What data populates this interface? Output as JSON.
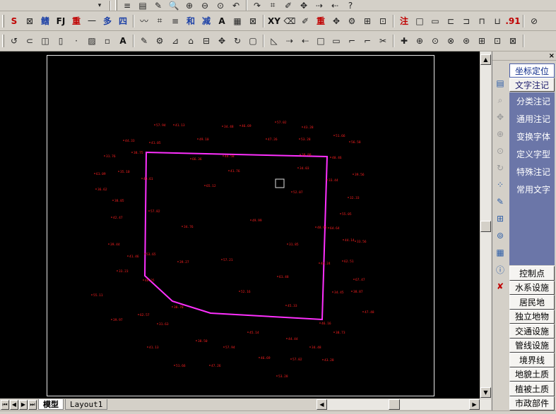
{
  "toolbar1": {
    "buttons": [
      "≡",
      "▤",
      "✎",
      "🔍",
      "⊕",
      "⊖",
      "⊙",
      "↶",
      "↷",
      "⌗",
      "✐",
      "✥",
      "⇢",
      "⇠",
      "?"
    ]
  },
  "toolbar2": {
    "buttons": [
      "S",
      "⊠",
      "鳍",
      "FJ",
      "重",
      "一",
      "多",
      "四",
      "〰",
      "⌗",
      "≡",
      "和",
      "减",
      "A",
      "▦",
      "⊠",
      "XY",
      "⌫",
      "✐",
      "重",
      "✥",
      "⚙",
      "⊞",
      "⊡",
      "注",
      "□",
      "▭",
      "⊏",
      "⊐",
      "⊓",
      "⊔",
      ".91",
      "⊘"
    ]
  },
  "toolbar3": {
    "buttons": [
      "↺",
      "⊂",
      "◫",
      "▯",
      "·",
      "▨",
      "▫",
      "A",
      "✎",
      "⚙",
      "⊿",
      "⌂",
      "⊟",
      "✥",
      "↻",
      "▢",
      "◺",
      "⇢",
      "⇠",
      "□",
      "▭",
      "⌐",
      "⌐",
      "✂",
      "✚",
      "⊕",
      "⊙",
      "⊗",
      "⊛",
      "⊞",
      "⊡",
      "⊠"
    ]
  },
  "right_panel": {
    "close_label": "×",
    "top_buttons": [
      "坐标定位",
      "文字注记"
    ],
    "menu_items": [
      "分类注记",
      "通用注记",
      "变换字体",
      "定义字型",
      "特殊注记",
      "常用文字"
    ],
    "categories": [
      "控制点",
      "水系设施",
      "居民地",
      "独立地物",
      "交通设施",
      "管线设施",
      "境界线",
      "地貌土质",
      "植被土质",
      "市政部件"
    ]
  },
  "bottom": {
    "tabs": [
      "模型",
      "Layout1"
    ],
    "nav_arrows": [
      "⏮",
      "◀",
      "▶",
      "⏭"
    ]
  },
  "plot": {
    "labels": [
      "57.94",
      "41.13",
      "34.48",
      "46.69",
      "57.02",
      "43.28",
      "51.66",
      "47.26",
      "53.28",
      "44.33",
      "41.05",
      "49.10",
      "56.58",
      "38.75",
      "44.58",
      "38.88",
      "40.46",
      "31.76",
      "35.10",
      "61.09",
      "66.36",
      "39.56",
      "49.61",
      "41.76",
      "34.03",
      "65.12",
      "52.07",
      "33.44",
      "36.62",
      "32.33",
      "38.05",
      "57.82",
      "55.05",
      "42.47",
      "49.99",
      "64.64",
      "48.95",
      "34.76",
      "39.44",
      "41.46",
      "44.14",
      "53.65",
      "31.85",
      "33.56",
      "39.27",
      "57.21",
      "44.24",
      "62.51",
      "33.23",
      "61.48",
      "67.47",
      "48.25",
      "34.45",
      "55.11",
      "38.87",
      "62.57",
      "38.70",
      "45.33",
      "52.16",
      "46.16",
      "39.97",
      "31.63",
      "38.73",
      "45.14",
      "47.48",
      "44.44",
      "38.50"
    ]
  }
}
